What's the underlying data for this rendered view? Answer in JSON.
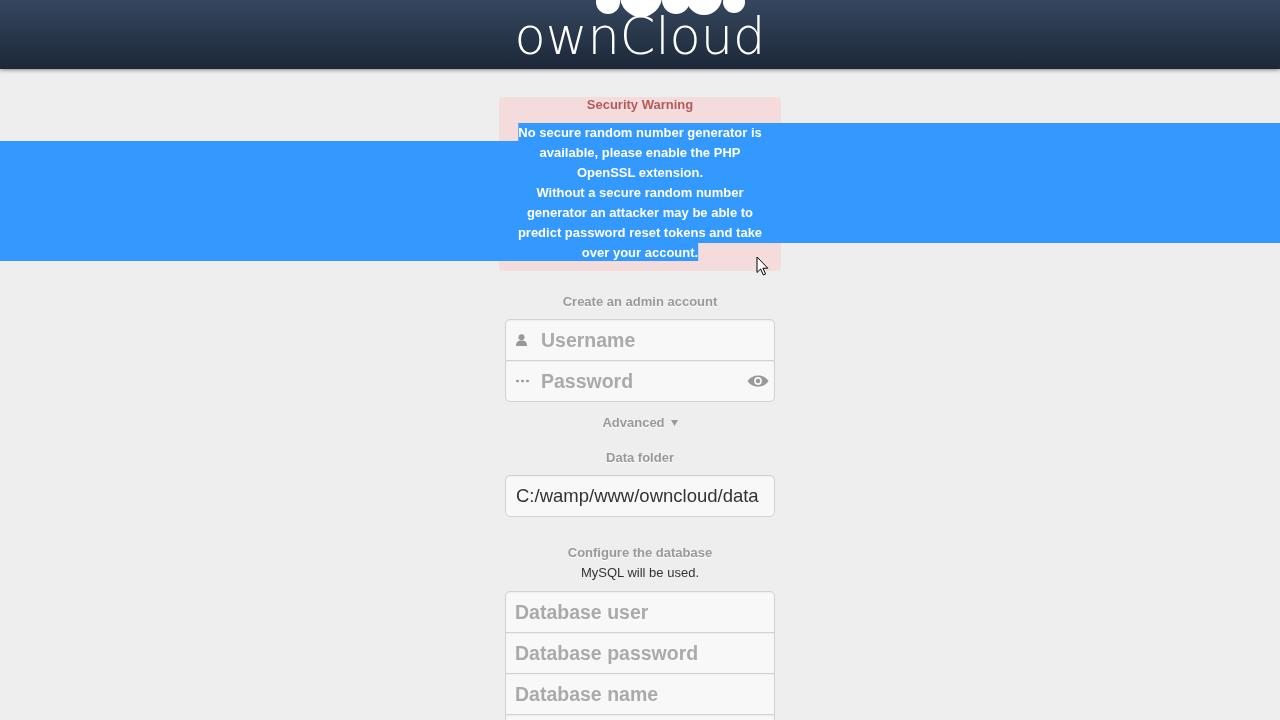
{
  "header": {
    "logo_text": "ownCloud"
  },
  "warning": {
    "title": "Security Warning",
    "paragraphs": [
      "No secure random number generator is available, please enable the PHP OpenSSL extension.",
      "Without a secure random number generator an attacker may be able to predict password reset tokens and take over your account."
    ],
    "text_selected": true
  },
  "admin": {
    "heading": "Create an admin account",
    "fields": [
      {
        "kind": "username",
        "placeholder": "Username"
      },
      {
        "kind": "password",
        "placeholder": "Password"
      }
    ]
  },
  "advanced": {
    "label": "Advanced",
    "expanded": true,
    "data_folder": {
      "label": "Data folder",
      "value": "C:/wamp/www/owncloud/data"
    },
    "database": {
      "heading": "Configure the database",
      "note": "MySQL will be used.",
      "fields": [
        {
          "kind": "text",
          "placeholder": "Database user"
        },
        {
          "kind": "text",
          "placeholder": "Database password"
        },
        {
          "kind": "text",
          "placeholder": "Database name"
        },
        {
          "kind": "text"
        }
      ]
    }
  }
}
